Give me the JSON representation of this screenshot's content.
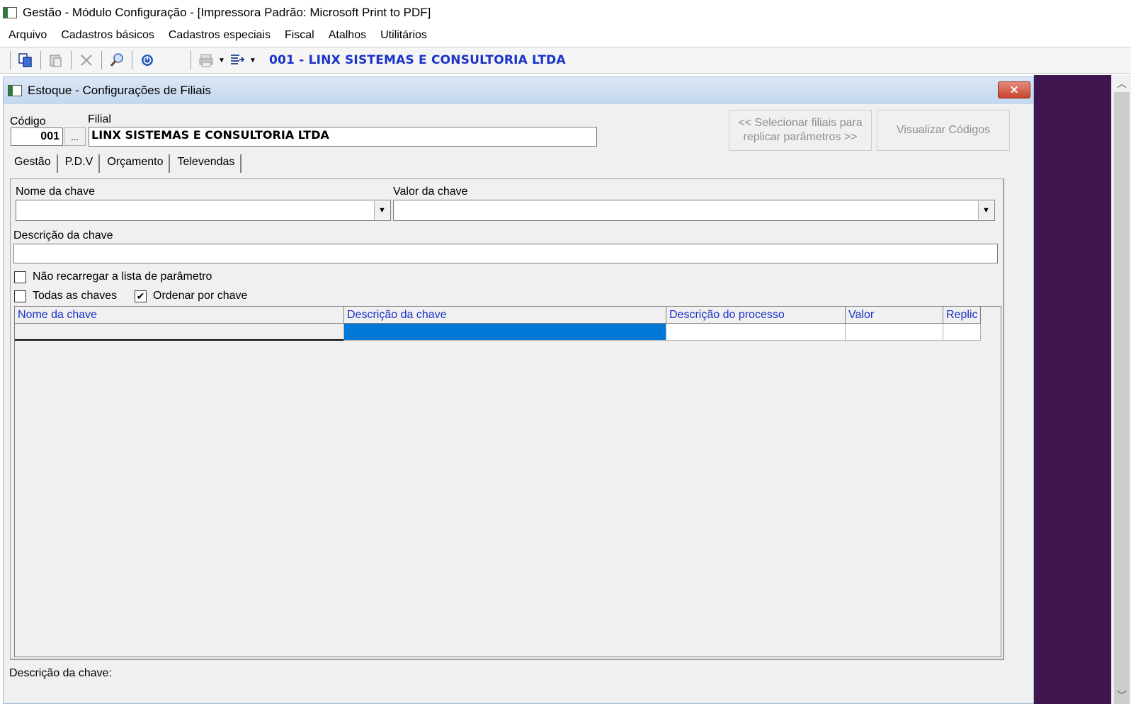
{
  "app": {
    "title": "Gestão  - Módulo Configuração - [Impressora Padrão: Microsoft Print to PDF]"
  },
  "menu": [
    "Arquivo",
    "Cadastros básicos",
    "Cadastros especiais",
    "Fiscal",
    "Atalhos",
    "Utilitários"
  ],
  "toolbar": {
    "company": "001 - LINX SISTEMAS E CONSULTORIA LTDA"
  },
  "child": {
    "title": "Estoque - Configurações de Filiais",
    "close_label": "✕"
  },
  "form": {
    "codigo_label": "Código",
    "codigo_value": "001",
    "lookup_label": "...",
    "filial_label": "Filial",
    "filial_value": "LINX SISTEMAS E CONSULTORIA LTDA",
    "select_filiais_line1": "<< Selecionar filiais para",
    "select_filiais_line2": "replicar parâmetros >>",
    "view_codes": "Visualizar Códigos"
  },
  "tabs": [
    "Gestão",
    "P.D.V",
    "Orçamento",
    "Televendas"
  ],
  "panel": {
    "nome_chave_label": "Nome da chave",
    "nome_chave_value": "",
    "valor_chave_label": "Valor da chave",
    "valor_chave_value": "",
    "descricao_label": "Descrição da chave",
    "descricao_value": "",
    "nao_recarregar": "Não recarregar a lista de parâmetro",
    "nao_recarregar_checked": false,
    "todas_chaves": "Todas as chaves",
    "todas_chaves_checked": false,
    "ordenar_chave": "Ordenar por chave",
    "ordenar_chave_checked": true
  },
  "grid": {
    "columns": [
      "Nome da chave",
      "Descrição  da chave",
      "Descrição do processo",
      "Valor",
      "Replic"
    ],
    "rows": [
      [
        "",
        "",
        "",
        "",
        ""
      ]
    ]
  },
  "footer": {
    "descricao_label": "Descrição da chave:"
  }
}
